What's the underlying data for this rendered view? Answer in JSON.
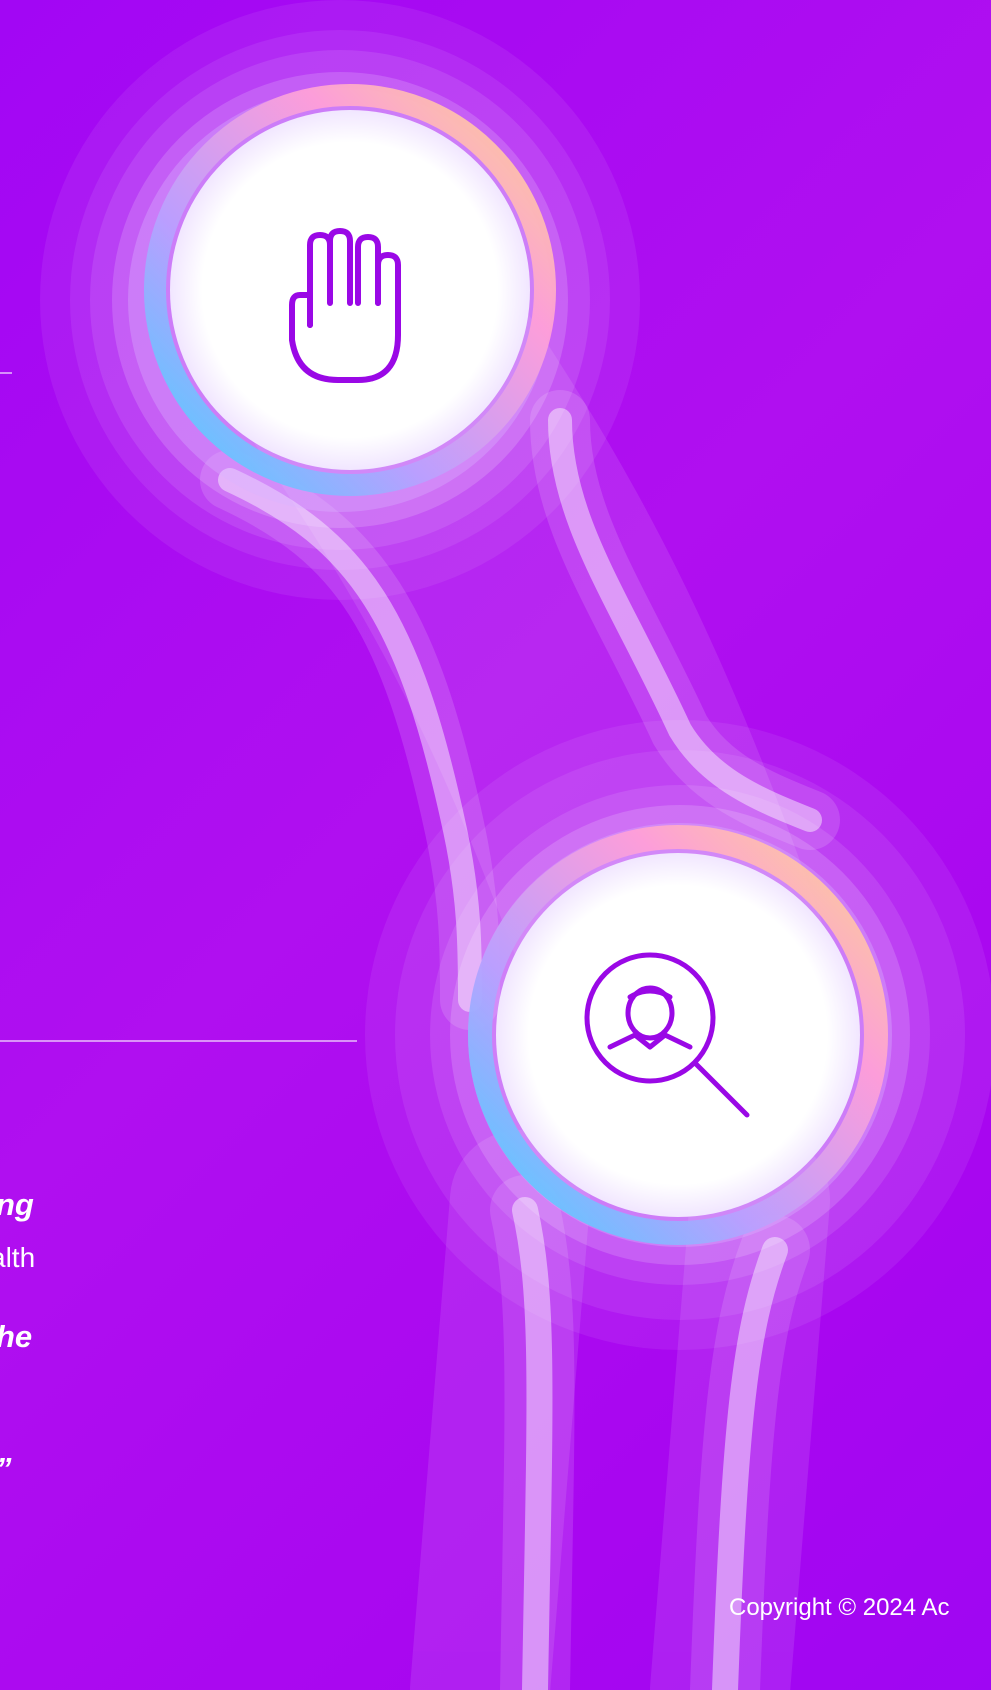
{
  "quote": {
    "lines": [
      "ng",
      "he",
      "”"
    ]
  },
  "attribution": "alth",
  "footer": {
    "copyright": "Copyright © 2024 Ac"
  },
  "icons": {
    "top_circle": "hand-icon",
    "bottom_circle": "person-search-icon"
  },
  "colors": {
    "background": "#a806f2",
    "accent": "#9a08e6",
    "ring_glow": "#ffffff"
  }
}
